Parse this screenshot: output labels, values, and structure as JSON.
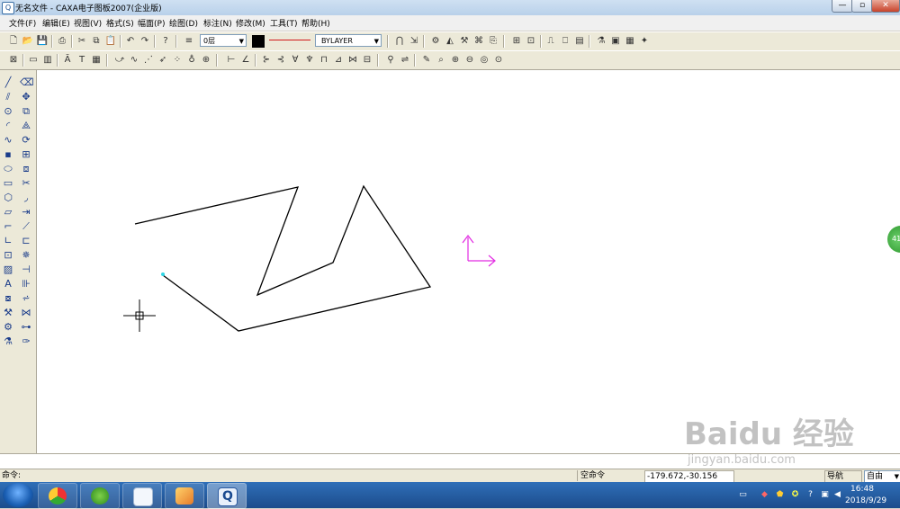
{
  "window": {
    "title": "无名文件 - CAXA电子图板2007(企业版)",
    "min_label": "—",
    "max_label": "▫",
    "close_label": "✕"
  },
  "menu": {
    "items": [
      "文件(F)",
      "编辑(E)",
      "视图(V)",
      "格式(S)",
      "幅面(P)",
      "绘图(D)",
      "标注(N)",
      "修改(M)",
      "工具(T)",
      "帮助(H)"
    ]
  },
  "properties_toolbar": {
    "layer": "0层",
    "linetype": "BYLAYER",
    "color": "#000000",
    "line_color": "#d11a1a"
  },
  "drawing": {
    "stroke_color": "#000000",
    "ucs_color": "#e22be2",
    "endpoint_color": "#2ed6e6"
  },
  "command_line": {
    "prompt": "命令:"
  },
  "status_bar": {
    "command_state": "空命令",
    "coordinates": "-179.672,-30.156",
    "grid_mode": "导航",
    "snap_mode": "自由"
  },
  "taskbar": {
    "time": "16:48",
    "date": "2018/9/29"
  },
  "watermark": {
    "text": "Baidu 经验",
    "url": "jingyan.baidu.com"
  }
}
